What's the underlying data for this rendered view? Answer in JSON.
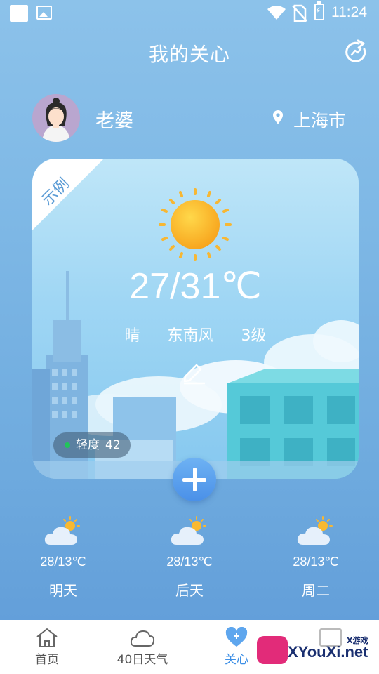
{
  "status_bar": {
    "time": "11:24"
  },
  "header": {
    "title": "我的关心"
  },
  "person": {
    "name": "老婆",
    "city": "上海市"
  },
  "card": {
    "badge": "示例",
    "temperature": "27/31℃",
    "condition": "晴",
    "wind_direction": "东南风",
    "wind_level": "3级",
    "air_quality_label": "轻度",
    "air_quality_value": "42"
  },
  "forecast": [
    {
      "temp": "28/13℃",
      "day": "明天"
    },
    {
      "temp": "28/13℃",
      "day": "后天"
    },
    {
      "temp": "28/13℃",
      "day": "周二"
    }
  ],
  "tabbar": {
    "items": [
      {
        "label": "首页",
        "icon": "home-icon"
      },
      {
        "label": "40日天气",
        "icon": "cloud-icon"
      },
      {
        "label": "关心",
        "icon": "heart-plus-icon",
        "active": true
      }
    ]
  },
  "watermark": {
    "text": "XYouXi.net",
    "small": "X游戏"
  },
  "colors": {
    "accent": "#3d8fe6",
    "aqi_dot": "#21c45a"
  }
}
